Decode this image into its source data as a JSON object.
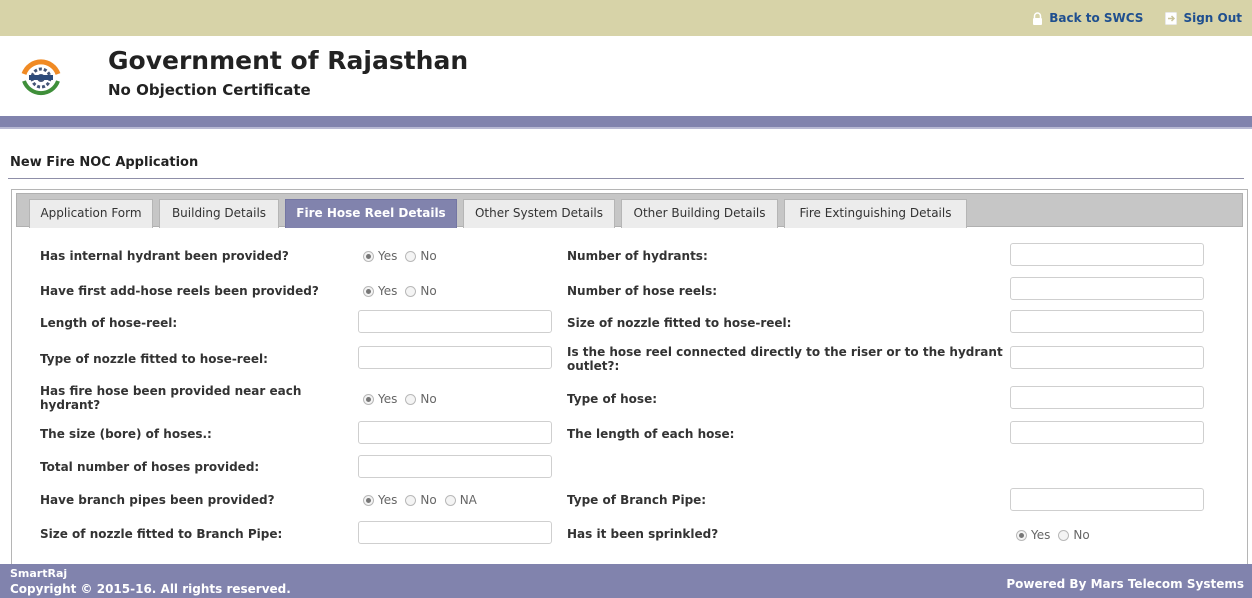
{
  "topbar": {
    "back_label": "Back to SWCS",
    "back_icon": "lock-icon",
    "signout_label": "Sign Out",
    "signout_icon": "exit-icon"
  },
  "header": {
    "title": "Government of Rajasthan",
    "subtitle": "No Objection Certificate"
  },
  "page": {
    "section_title": "New Fire NOC Application"
  },
  "tabs": [
    {
      "label": "Application Form",
      "active": false
    },
    {
      "label": "Building Details",
      "active": false
    },
    {
      "label": "Fire Hose Reel Details",
      "active": true
    },
    {
      "label": "Other System Details",
      "active": false
    },
    {
      "label": "Other Building Details",
      "active": false
    },
    {
      "label": "Fire Extinguishing Details",
      "active": false
    }
  ],
  "form": {
    "internal_hydrant": {
      "label": "Has internal hydrant been provided?",
      "options": [
        "Yes",
        "No"
      ],
      "selected": "Yes"
    },
    "hydrant_count": {
      "label": "Number of hydrants:",
      "value": ""
    },
    "first_aid_hose_reels": {
      "label": "Have first add-hose reels been provided?",
      "options": [
        "Yes",
        "No"
      ],
      "selected": "Yes"
    },
    "hose_reel_count": {
      "label": "Number of hose reels:",
      "value": ""
    },
    "hose_reel_length": {
      "label": "Length of hose-reel:",
      "value": ""
    },
    "nozzle_size_hose_reel": {
      "label": "Size of nozzle fitted to hose-reel:",
      "value": ""
    },
    "nozzle_type_hose_reel": {
      "label": "Type of nozzle fitted to hose-reel:",
      "value": ""
    },
    "hose_reel_connection": {
      "label": "Is the hose reel connected directly to the riser or to the hydrant outlet?:",
      "value": ""
    },
    "fire_hose_near_hydrant": {
      "label": "Has fire hose been provided near each hydrant?",
      "options": [
        "Yes",
        "No"
      ],
      "selected": "Yes"
    },
    "hose_type": {
      "label": "Type of hose:",
      "value": ""
    },
    "hose_bore_size": {
      "label": "The size (bore) of hoses.:",
      "value": ""
    },
    "hose_length": {
      "label": "The length of each hose:",
      "value": ""
    },
    "total_hoses": {
      "label": "Total number of hoses provided:",
      "value": ""
    },
    "branch_pipes": {
      "label": "Have branch pipes been provided?",
      "options": [
        "Yes",
        "No",
        "NA"
      ],
      "selected": "Yes"
    },
    "branch_pipe_type": {
      "label": "Type of Branch Pipe:",
      "value": ""
    },
    "nozzle_size_branch_pipe": {
      "label": "Size of nozzle fitted to Branch Pipe:",
      "value": ""
    },
    "sprinkled": {
      "label": "Has it been sprinkled?",
      "options": [
        "Yes",
        "No"
      ],
      "selected": "Yes"
    }
  },
  "footer": {
    "brand": "SmartRaj",
    "copyright": "Copyright © 2015-16. All rights reserved.",
    "powered_by": "Powered By Mars Telecom Systems"
  },
  "colors": {
    "topbar": "#d7d3a8",
    "accent": "#8183ad",
    "link": "#1f4f8f"
  }
}
